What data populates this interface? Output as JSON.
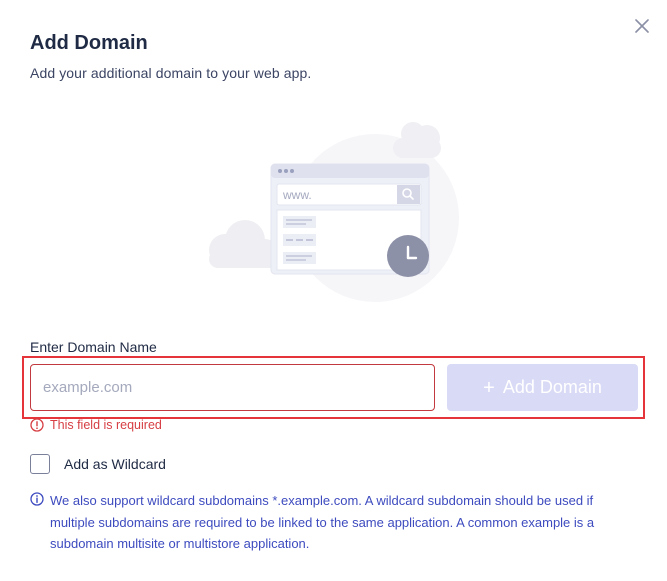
{
  "dialog": {
    "title": "Add Domain",
    "subtitle": "Add your additional domain to your web app."
  },
  "illustration": {
    "address_text": "www."
  },
  "form": {
    "label": "Enter Domain Name",
    "input_value": "",
    "input_placeholder": "example.com",
    "add_button_label": "Add Domain",
    "add_button_icon": "plus-icon",
    "error_text": "This field is required",
    "wildcard_label": "Add as Wildcard",
    "wildcard_checked": false
  },
  "info": {
    "text": "We also support wildcard subdomains *.example.com. A wildcard subdomain should be used if multiple subdomains are required to be linked to the same application. A common example is a subdomain multisite or multistore application."
  },
  "colors": {
    "primary_disabled": "#d9daf5",
    "error": "#d63e43",
    "info": "#3d4bbf",
    "highlight": "#e5343a"
  }
}
